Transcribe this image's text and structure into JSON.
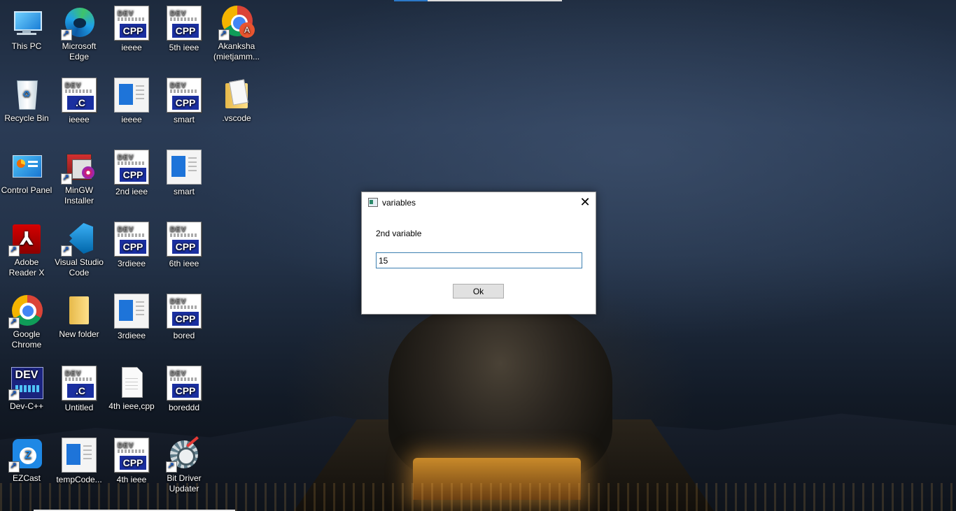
{
  "desktop": {
    "icons": [
      {
        "label": "This PC",
        "icon": "computer-icon"
      },
      {
        "label": "Microsoft Edge",
        "icon": "edge-icon"
      },
      {
        "label": "ieeee",
        "icon": "dev-cpp-file-icon",
        "badge": "CPP"
      },
      {
        "label": "5th ieee",
        "icon": "dev-cpp-file-icon",
        "badge": "CPP"
      },
      {
        "label": "Akanksha (mietjamm...",
        "icon": "chrome-profile-icon",
        "avatar_letter": "A"
      },
      {
        "label": "Recycle Bin",
        "icon": "recycle-bin-icon"
      },
      {
        "label": "ieeee",
        "icon": "dev-c-file-icon",
        "badge": ".C"
      },
      {
        "label": "ieeee",
        "icon": "document-icon"
      },
      {
        "label": "smart",
        "icon": "dev-cpp-file-icon",
        "badge": "CPP"
      },
      {
        "label": ".vscode",
        "icon": "folder-icon"
      },
      {
        "label": "Control Panel",
        "icon": "control-panel-icon"
      },
      {
        "label": "MinGW Installer",
        "icon": "installer-icon"
      },
      {
        "label": "2nd ieee",
        "icon": "dev-cpp-file-icon",
        "badge": "CPP"
      },
      {
        "label": "smart",
        "icon": "document-icon"
      },
      {
        "label": "Adobe Reader X",
        "icon": "adobe-reader-icon"
      },
      {
        "label": "Visual Studio Code",
        "icon": "vscode-icon"
      },
      {
        "label": "3rdieee",
        "icon": "dev-cpp-file-icon",
        "badge": "CPP"
      },
      {
        "label": "6th ieee",
        "icon": "dev-cpp-file-icon",
        "badge": "CPP"
      },
      {
        "label": "Google Chrome",
        "icon": "chrome-icon"
      },
      {
        "label": "New folder",
        "icon": "folder-icon"
      },
      {
        "label": "3rdieee",
        "icon": "document-icon"
      },
      {
        "label": "bored",
        "icon": "dev-cpp-file-icon",
        "badge": "CPP"
      },
      {
        "label": "Dev-C++",
        "icon": "dev-cpp-app-icon",
        "badge": "DEV"
      },
      {
        "label": "Untitled",
        "icon": "dev-c-file-icon",
        "badge": ".C"
      },
      {
        "label": "4th ieee,cpp",
        "icon": "blank-file-icon"
      },
      {
        "label": "boreddd",
        "icon": "dev-cpp-file-icon",
        "badge": "CPP"
      },
      {
        "label": "EZCast",
        "icon": "ezcast-icon",
        "badge": "Z"
      },
      {
        "label": "tempCode...",
        "icon": "document-icon"
      },
      {
        "label": "4th ieee",
        "icon": "dev-cpp-file-icon",
        "badge": "CPP"
      },
      {
        "label": "Bit Driver Updater",
        "icon": "bit-driver-updater-icon"
      }
    ]
  },
  "dialog": {
    "title": "variables",
    "close_glyph": "✕",
    "prompt": "2nd variable",
    "input_value": "15",
    "ok_label": "Ok"
  }
}
